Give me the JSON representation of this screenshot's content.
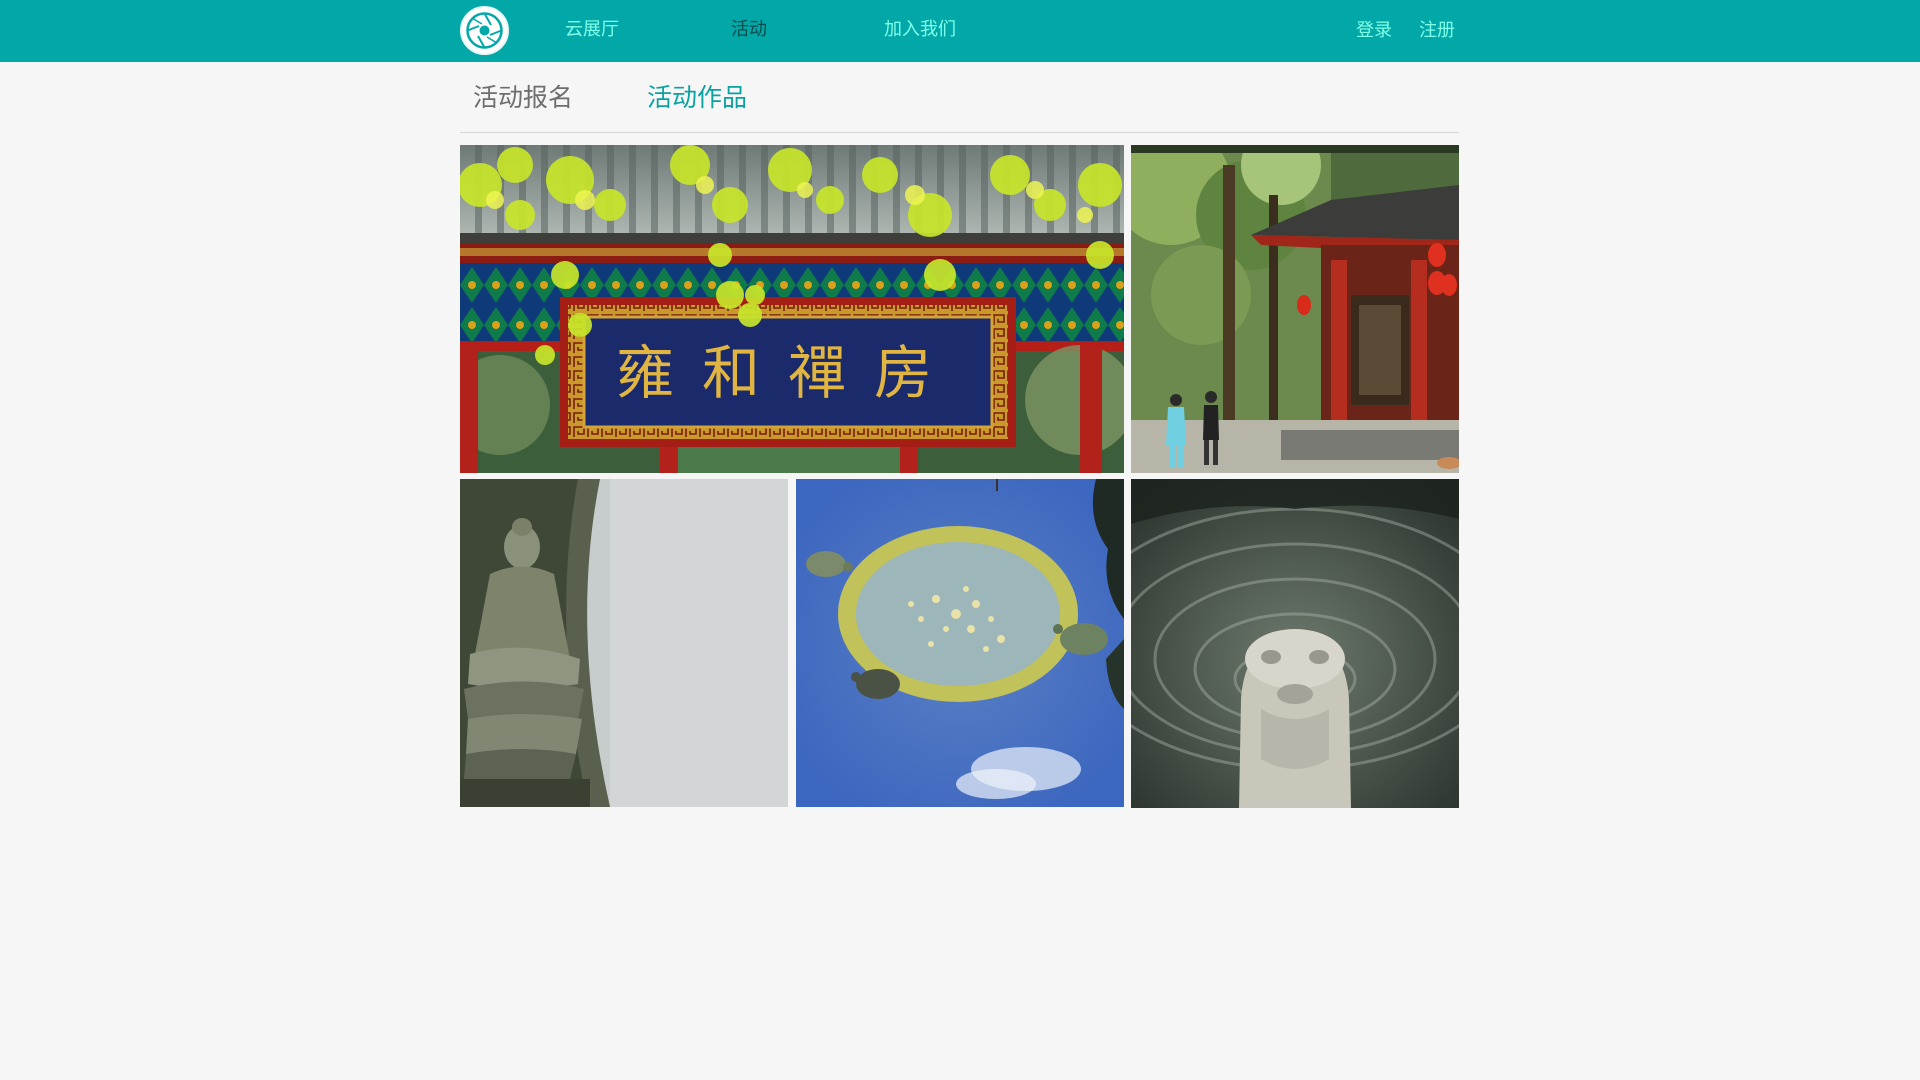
{
  "header": {
    "logo_icon": "camera-aperture-icon",
    "nav": {
      "gallery": "云展厅",
      "activity": "活动",
      "join": "加入我们"
    },
    "login": "登录",
    "register": "注册"
  },
  "tabs": {
    "signup": "活动报名",
    "works": "活动作品",
    "active": "works"
  },
  "gallery": {
    "photos": [
      {
        "subject": "temple-gate-plaque-photo",
        "plaque_text": "雍和禪房"
      },
      {
        "subject": "tai-chi-pavilion-photo"
      },
      {
        "subject": "buddha-niche-photo"
      },
      {
        "subject": "turtle-pond-photo"
      },
      {
        "subject": "stone-beast-fountain-photo"
      }
    ]
  },
  "colors": {
    "accent": "#02a8a8",
    "nav_highlight": "#7fffe8",
    "active_tab": "#0aa3a0"
  }
}
